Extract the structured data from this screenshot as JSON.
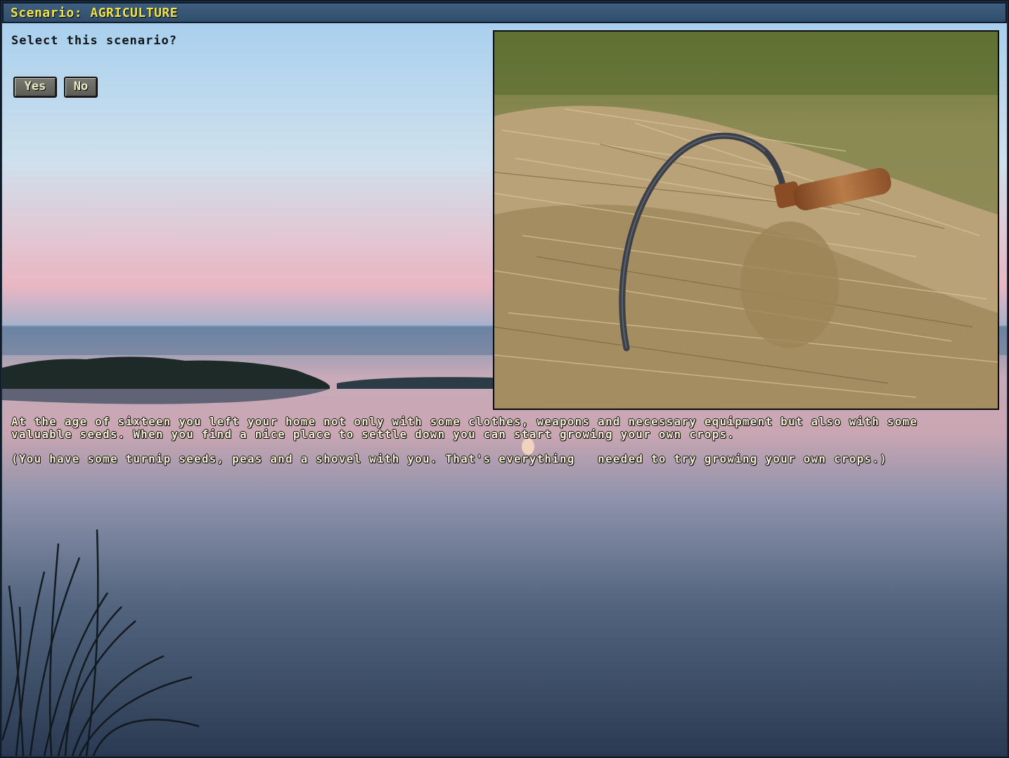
{
  "window": {
    "title": "Scenario: AGRICULTURE"
  },
  "dialog": {
    "question": "Select this scenario?",
    "yes_label": "Yes",
    "no_label": "No"
  },
  "description": {
    "paragraph_1": "At the age of sixteen you left your home not only with some clothes, weapons and necessary equipment but also with some valuable seeds. When you find a nice place to settle down you can start growing your own crops.",
    "paragraph_2": "(You have some turnip seeds, peas and a shovel with you. That's everything   needed to try growing your own crops.)"
  },
  "colors": {
    "title_text": "#f2e24a",
    "title_bar": "#2f4d6b",
    "body_text": "#f6f1d4",
    "button_face": "#6b6b63"
  },
  "icons": {
    "scenario_picture": "sickle-on-straw-image",
    "background": "lake-sunset-image"
  }
}
